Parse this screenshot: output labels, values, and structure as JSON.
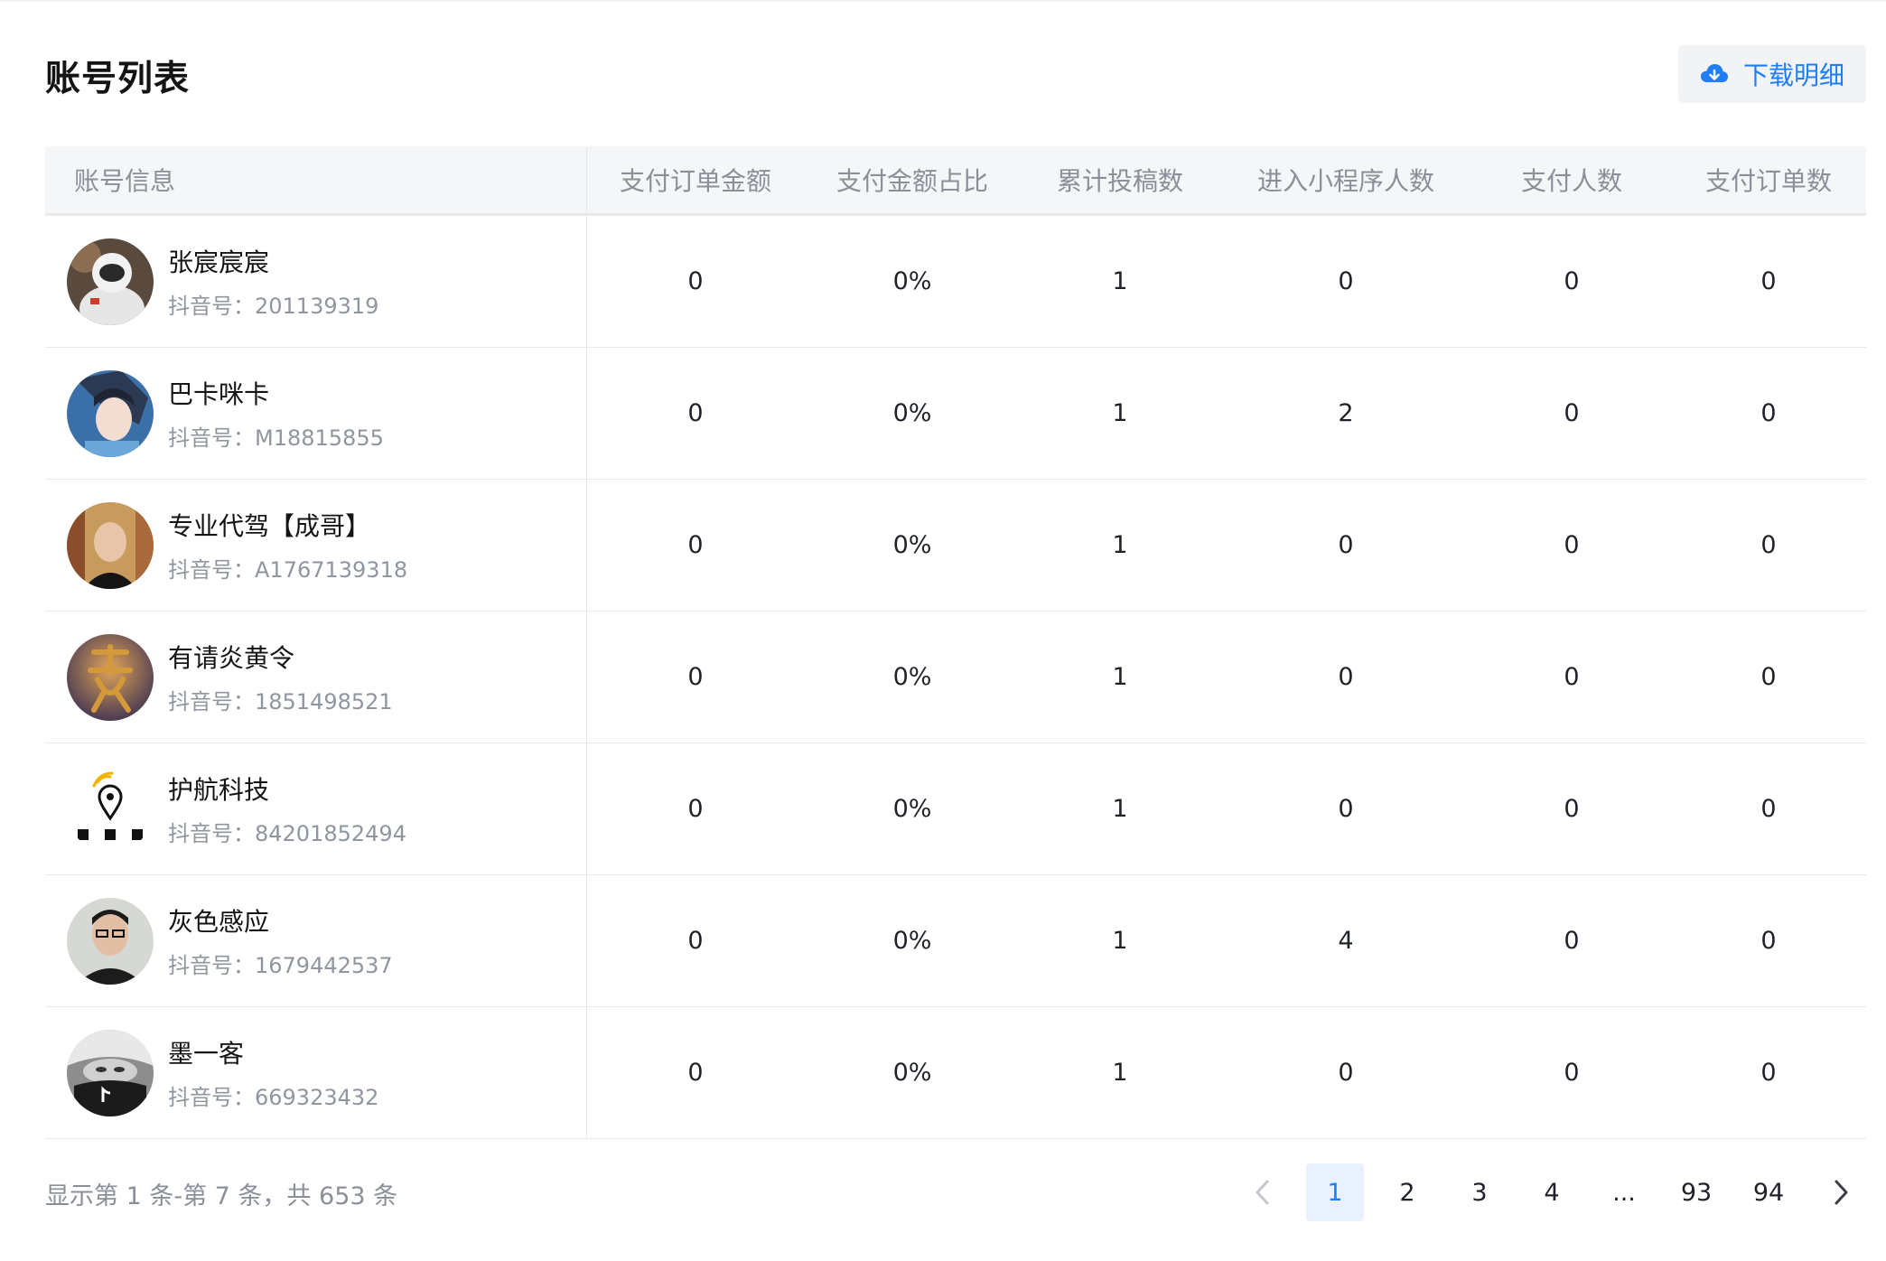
{
  "page": {
    "title": "账号列表"
  },
  "toolbar": {
    "download_label": "下载明细",
    "download_icon": "cloud-download-icon",
    "accent_color": "#1f7df6"
  },
  "table": {
    "columns": [
      "账号信息",
      "支付订单金额",
      "支付金额占比",
      "累计投稿数",
      "进入小程序人数",
      "支付人数",
      "支付订单数"
    ],
    "id_prefix": "抖音号：",
    "rows": [
      {
        "name": "张宸宸宸",
        "douyin_id": "201139319",
        "pay_amount": "0",
        "pay_ratio": "0%",
        "posts": "1",
        "mini_program_users": "0",
        "payers": "0",
        "orders": "0"
      },
      {
        "name": "巴卡咪卡",
        "douyin_id": "M18815855",
        "pay_amount": "0",
        "pay_ratio": "0%",
        "posts": "1",
        "mini_program_users": "2",
        "payers": "0",
        "orders": "0"
      },
      {
        "name": "专业代驾【成哥】",
        "douyin_id": "A1767139318",
        "pay_amount": "0",
        "pay_ratio": "0%",
        "posts": "1",
        "mini_program_users": "0",
        "payers": "0",
        "orders": "0"
      },
      {
        "name": "有请炎黄令",
        "douyin_id": "1851498521",
        "pay_amount": "0",
        "pay_ratio": "0%",
        "posts": "1",
        "mini_program_users": "0",
        "payers": "0",
        "orders": "0"
      },
      {
        "name": "护航科技",
        "douyin_id": "84201852494",
        "pay_amount": "0",
        "pay_ratio": "0%",
        "posts": "1",
        "mini_program_users": "0",
        "payers": "0",
        "orders": "0"
      },
      {
        "name": "灰色感应",
        "douyin_id": "1679442537",
        "pay_amount": "0",
        "pay_ratio": "0%",
        "posts": "1",
        "mini_program_users": "4",
        "payers": "0",
        "orders": "0"
      },
      {
        "name": "墨一客",
        "douyin_id": "669323432",
        "pay_amount": "0",
        "pay_ratio": "0%",
        "posts": "1",
        "mini_program_users": "0",
        "payers": "0",
        "orders": "0"
      }
    ]
  },
  "footer": {
    "summary": "显示第 1 条-第 7 条，共 653 条"
  },
  "pagination": {
    "prev_icon": "chevron-left-icon",
    "next_icon": "chevron-right-icon",
    "pages": [
      "1",
      "2",
      "3",
      "4",
      "...",
      "93",
      "94"
    ],
    "current": "1"
  }
}
